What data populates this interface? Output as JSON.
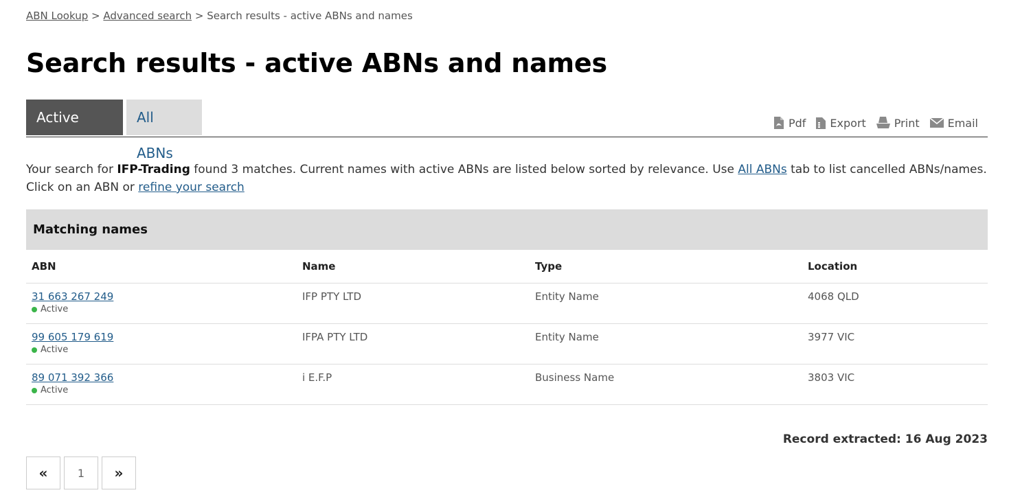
{
  "breadcrumb": {
    "home": "ABN Lookup",
    "sep1": ">",
    "advanced": "Advanced search",
    "sep2": ">",
    "current": "Search results - active ABNs and names"
  },
  "page": {
    "title": "Search results - active ABNs and names"
  },
  "tabs": [
    {
      "label": "Active ABNs",
      "active": true
    },
    {
      "label": "All ABNs",
      "active": false
    }
  ],
  "tools": [
    {
      "label": "Pdf",
      "icon": "pdf-icon"
    },
    {
      "label": "Export",
      "icon": "export-icon"
    },
    {
      "label": "Print",
      "icon": "print-icon"
    },
    {
      "label": "Email",
      "icon": "email-icon"
    }
  ],
  "intro": {
    "prefix": "Your search for",
    "term": "IFP-Trading",
    "middle": "found 3 matches. Current names with active ABNs are listed below sorted by relevance. Use",
    "all_abns_link": "All ABNs",
    "suffix": "tab to list cancelled ABNs/names. Click on an ABN or",
    "refine_link": "refine your search"
  },
  "panel": {
    "title": "Matching names"
  },
  "table": {
    "headers": {
      "abn": "ABN",
      "name": "Name",
      "type": "Type",
      "location": "Location"
    },
    "rows": [
      {
        "abn": "31 663 267 249",
        "status": "Active",
        "name": "IFP PTY LTD",
        "type": "Entity Name",
        "location": "4068 QLD"
      },
      {
        "abn": "99 605 179 619",
        "status": "Active",
        "name": "IFPA PTY LTD",
        "type": "Entity Name",
        "location": "3977 VIC"
      },
      {
        "abn": "89 071 392 366",
        "status": "Active",
        "name": "i E.F.P",
        "type": "Business Name",
        "location": "3803 VIC"
      }
    ]
  },
  "footer": {
    "extracted": "Record extracted: 16 Aug 2023"
  },
  "pager": {
    "prev": "«",
    "current": "1",
    "next": "»"
  },
  "colors": {
    "accent_link": "#225c8a",
    "tab_active_bg": "#555555",
    "tab_inactive_bg": "#dddddd",
    "status_active": "#3bb54a"
  }
}
